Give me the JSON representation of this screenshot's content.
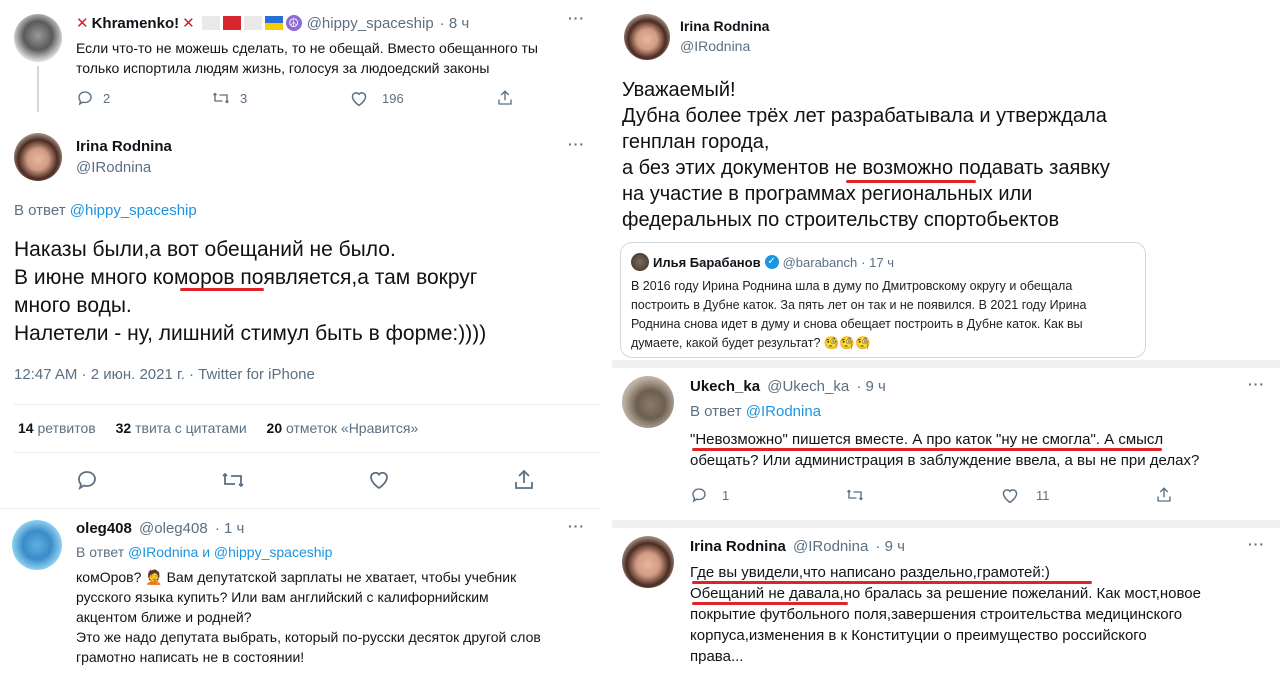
{
  "left": {
    "tweet1": {
      "name": "Khramenko!",
      "handle": "@hippy_spaceship",
      "time": "· 8 ч",
      "text_l1": "Если что-то не можешь сделать, то не обещай. Вместо обещанного ты",
      "text_l2": "только испортила людям жизнь, голосуя за людоедский законы",
      "replies": "2",
      "retweets": "3",
      "likes": "196"
    },
    "main": {
      "name": "Irina Rodnina",
      "handle": "@IRodnina",
      "reply_prefix": "В ответ",
      "reply_to": "@hippy_spaceship",
      "line1": "Наказы были,а вот обещаний не было.",
      "line2": "В июне много коморов появляется,а там вокруг",
      "line3": "много воды.",
      "line4": "Налетели - ну, лишний стимул быть в форме:))))",
      "meta": "12:47 AM · 2 июн. 2021 г. · Twitter for iPhone",
      "retweets_count": "14",
      "retweets_label": "ретвитов",
      "quotes_count": "32",
      "quotes_label": "твита с цитатами",
      "likes_count": "20",
      "likes_label": "отметок «Нравится»"
    },
    "oleg": {
      "name": "oleg408",
      "handle": "@oleg408",
      "time": "· 1 ч",
      "reply_prefix": "В ответ",
      "reply_to1": "@IRodnina",
      "reply_and": "и",
      "reply_to2": "@hippy_spaceship",
      "l1": "комОров? 🤦 Вам депутатской зарплаты не хватает, чтобы учебник",
      "l2": "русского языка купить? Или вам английский с калифорнийским",
      "l3": "акцентом ближе и родней?",
      "l4": "Это же надо депутата выбрать, который по-русски десяток другой слов",
      "l5": "грамотно написать не в состоянии!"
    }
  },
  "right": {
    "top": {
      "name": "Irina Rodnina",
      "handle": "@IRodnina",
      "l1": "Уважаемый!",
      "l2": "Дубна более трёх лет разрабатывала и утверждала",
      "l3": "генплан города,",
      "l4": "а без этих документов не возможно подавать заявку",
      "l5": "на участие в программах региональных или",
      "l6": "федеральных по строительству спортобьектов"
    },
    "quote": {
      "name": "Илья Барабанов",
      "handle": "@barabanch",
      "time": "· 17 ч",
      "l1": "В 2016 году Ирина Роднина шла в думу по Дмитровскому округу и обещала",
      "l2": "построить в Дубне каток. За пять лет он так и не появился. В 2021 году Ирина",
      "l3": "Роднина снова идет в думу и снова обещает построить в Дубне каток. Как вы",
      "l4": "думаете, какой будет результат? 🧐🧐🧐"
    },
    "ukech": {
      "name": "Ukech_ka",
      "handle": "@Ukech_ka",
      "time": "· 9 ч",
      "reply_prefix": "В ответ",
      "reply_to": "@IRodnina",
      "l1": "\"Невозможно\" пишется вместе. А про каток \"ну не смогла\". А смысл",
      "l2": "обещать? Или администрация в заблуждение ввела, а вы не при делах?",
      "replies": "1",
      "likes": "11"
    },
    "rodnina2": {
      "name": "Irina Rodnina",
      "handle": "@IRodnina",
      "time": "· 9 ч",
      "l1": "Где вы увидели,что написано раздельно,грамотей:)",
      "l2": "Обещаний не давала,но бралась за решение пожеланий. Как мост,новое",
      "l3": "покрытие футбольного поля,завершения строительства медицинского",
      "l4": "корпуса,изменения в к Конституции о преимущество российского",
      "l5": "права..."
    }
  },
  "colors": {
    "accent": "#1b95e0",
    "underline": "#e0232b",
    "muted": "#5b7083"
  }
}
